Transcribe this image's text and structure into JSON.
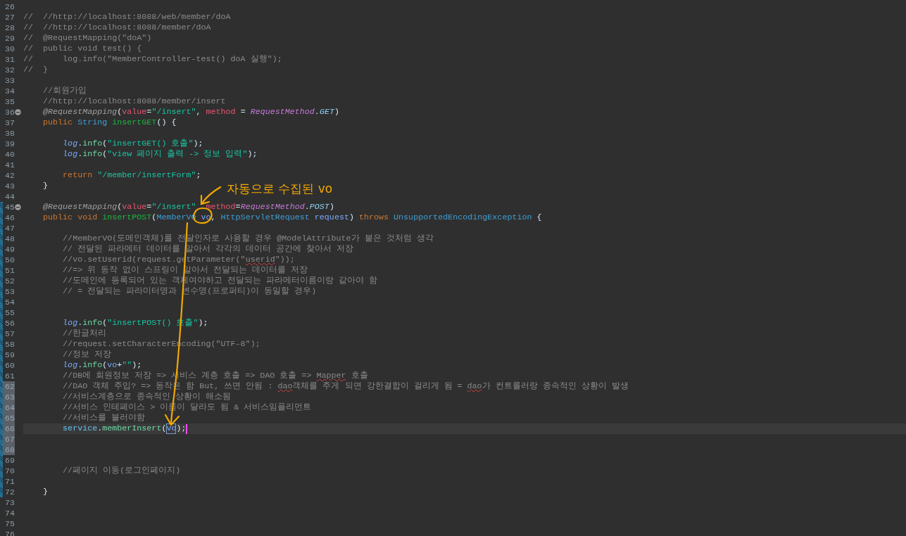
{
  "editor": {
    "lines": [
      {
        "number": "26"
      },
      {
        "number": "27",
        "tokens": [
          {
            "kind": "comment",
            "text": "//  //http://localhost:8088/web/member/doA"
          }
        ]
      },
      {
        "number": "28",
        "tokens": [
          {
            "kind": "comment",
            "text": "//  //http://localhost:8088/member/doA"
          }
        ]
      },
      {
        "number": "29",
        "tokens": [
          {
            "kind": "comment",
            "text": "//  @RequestMapping(\"doA\")"
          }
        ]
      },
      {
        "number": "30",
        "tokens": [
          {
            "kind": "comment",
            "text": "//  public void test() {"
          }
        ]
      },
      {
        "number": "31",
        "tokens": [
          {
            "kind": "comment",
            "text": "//      log.info(\"MemberController-test() doA 실행\");"
          }
        ]
      },
      {
        "number": "32",
        "tokens": [
          {
            "kind": "comment",
            "text": "//  }"
          }
        ]
      },
      {
        "number": "33"
      },
      {
        "number": "34",
        "tokens": [
          {
            "kind": "comment",
            "text": "    //회원가입"
          }
        ]
      },
      {
        "number": "35",
        "tokens": [
          {
            "kind": "comment",
            "text": "    //http://localhost:8088/member/insert"
          }
        ]
      },
      {
        "number": "36",
        "expanded": true,
        "tokens": [
          {
            "kind": "annotation",
            "text": "    @RequestMapping"
          },
          {
            "kind": "plain",
            "text": "("
          },
          {
            "kind": "param",
            "text": "value"
          },
          {
            "kind": "plain",
            "text": "="
          },
          {
            "kind": "string",
            "text": "\"/insert\""
          },
          {
            "kind": "plain",
            "text": ", "
          },
          {
            "kind": "param",
            "text": "method"
          },
          {
            "kind": "plain",
            "text": " = "
          },
          {
            "kind": "enum",
            "text": "RequestMethod"
          },
          {
            "kind": "plain",
            "text": "."
          },
          {
            "kind": "constant",
            "text": "GET"
          },
          {
            "kind": "plain",
            "text": ")"
          }
        ]
      },
      {
        "number": "37",
        "tokens": [
          {
            "kind": "keyword",
            "text": "    public "
          },
          {
            "kind": "type",
            "text": "String "
          },
          {
            "kind": "method",
            "text": "insertGET"
          },
          {
            "kind": "plain",
            "text": "() {"
          }
        ]
      },
      {
        "number": "38"
      },
      {
        "number": "39",
        "tokens": [
          {
            "kind": "static",
            "text": "        log"
          },
          {
            "kind": "plain",
            "text": "."
          },
          {
            "kind": "call",
            "text": "info"
          },
          {
            "kind": "plain",
            "text": "("
          },
          {
            "kind": "string",
            "text": "\"insertGET() 호출\""
          },
          {
            "kind": "plain",
            "text": ");"
          }
        ]
      },
      {
        "number": "40",
        "tokens": [
          {
            "kind": "static",
            "text": "        log"
          },
          {
            "kind": "plain",
            "text": "."
          },
          {
            "kind": "call",
            "text": "info"
          },
          {
            "kind": "plain",
            "text": "("
          },
          {
            "kind": "string",
            "text": "\"view 페이지 출력 -> 정보 입력\""
          },
          {
            "kind": "plain",
            "text": ");"
          }
        ]
      },
      {
        "number": "41"
      },
      {
        "number": "42",
        "tokens": [
          {
            "kind": "keyword",
            "text": "        return "
          },
          {
            "kind": "string",
            "text": "\"/member/insertForm\""
          },
          {
            "kind": "plain",
            "text": ";"
          }
        ]
      },
      {
        "number": "43",
        "tokens": [
          {
            "kind": "plain",
            "text": "    }"
          }
        ]
      },
      {
        "number": "44"
      },
      {
        "number": "45",
        "expanded": true,
        "changed": true,
        "tokens": [
          {
            "kind": "annotation",
            "text": "    @RequestMapping"
          },
          {
            "kind": "plain",
            "text": "("
          },
          {
            "kind": "param",
            "text": "value"
          },
          {
            "kind": "plain",
            "text": "="
          },
          {
            "kind": "string",
            "text": "\"/insert\""
          },
          {
            "kind": "param",
            "text": "  method"
          },
          {
            "kind": "plain",
            "text": "="
          },
          {
            "kind": "enum",
            "text": "RequestMethod"
          },
          {
            "kind": "plain",
            "text": "."
          },
          {
            "kind": "constant",
            "text": "POST"
          },
          {
            "kind": "plain",
            "text": ")"
          }
        ]
      },
      {
        "number": "46",
        "changed": true,
        "tokens": [
          {
            "kind": "keyword",
            "text": "    public void "
          },
          {
            "kind": "method",
            "text": "insertPOST"
          },
          {
            "kind": "plain",
            "text": "("
          },
          {
            "kind": "type",
            "text": "MemberVO "
          },
          {
            "kind": "local",
            "text": "vo"
          },
          {
            "kind": "plain",
            "text": ", "
          },
          {
            "kind": "type",
            "text": "HttpServletRequest "
          },
          {
            "kind": "local",
            "text": "request"
          },
          {
            "kind": "plain",
            "text": ") "
          },
          {
            "kind": "keyword",
            "text": "throws "
          },
          {
            "kind": "type",
            "text": "UnsupportedEncodingException"
          },
          {
            "kind": "plain",
            "text": " {"
          }
        ]
      },
      {
        "number": "47",
        "changed": true
      },
      {
        "number": "48",
        "changed": true,
        "tokens": [
          {
            "kind": "comment",
            "text": "        //MemberVO(도메인객체)를 전달인자로 사용할 경우 @ModelAttribute가 붙은 것처럼 생각"
          }
        ]
      },
      {
        "number": "49",
        "changed": true,
        "tokens": [
          {
            "kind": "comment",
            "text": "        // 전달된 파라메터 데이터를 알아서 각각의 데이터 공간에 찾아서 저장"
          }
        ]
      },
      {
        "number": "50",
        "changed": true,
        "tokens": [
          {
            "kind": "comment",
            "text": "        //vo.setUserid(request.getParameter(\""
          },
          {
            "kind": "comment",
            "text": "userid",
            "warning": true
          },
          {
            "kind": "comment",
            "text": "\"));"
          }
        ]
      },
      {
        "number": "51",
        "changed": true,
        "tokens": [
          {
            "kind": "comment",
            "text": "        //=> 위 동작 없이 스프링이 알아서 전달되는 데이터를 저장"
          }
        ]
      },
      {
        "number": "52",
        "changed": true,
        "tokens": [
          {
            "kind": "comment",
            "text": "        //도메인에 등록되어 있는 객체여야하고 전달되는 파라메터이름이랑 같아야 함"
          }
        ]
      },
      {
        "number": "53",
        "changed": true,
        "tokens": [
          {
            "kind": "comment",
            "text": "        // = 전달되는 파라미터명과 변수명(프로퍼티)이 동일할 경우)"
          }
        ]
      },
      {
        "number": "54",
        "changed": true
      },
      {
        "number": "55",
        "changed": true
      },
      {
        "number": "56",
        "changed": true,
        "tokens": [
          {
            "kind": "static",
            "text": "        log"
          },
          {
            "kind": "plain",
            "text": "."
          },
          {
            "kind": "call",
            "text": "info"
          },
          {
            "kind": "plain",
            "text": "("
          },
          {
            "kind": "string",
            "text": "\"insertPOST() 호출\""
          },
          {
            "kind": "plain",
            "text": ");"
          }
        ]
      },
      {
        "number": "57",
        "changed": true,
        "tokens": [
          {
            "kind": "comment",
            "text": "        //한글처리"
          }
        ]
      },
      {
        "number": "58",
        "changed": true,
        "tokens": [
          {
            "kind": "comment",
            "text": "        //request.setCharacterEncoding(\"UTF-8\");"
          }
        ]
      },
      {
        "number": "59",
        "changed": true,
        "tokens": [
          {
            "kind": "comment",
            "text": "        //정보 저장"
          }
        ]
      },
      {
        "number": "60",
        "changed": true,
        "tokens": [
          {
            "kind": "static",
            "text": "        log"
          },
          {
            "kind": "plain",
            "text": "."
          },
          {
            "kind": "call",
            "text": "info"
          },
          {
            "kind": "plain",
            "text": "("
          },
          {
            "kind": "local",
            "text": "vo"
          },
          {
            "kind": "plain",
            "text": "+"
          },
          {
            "kind": "string",
            "text": "\"\""
          },
          {
            "kind": "plain",
            "text": ");"
          }
        ]
      },
      {
        "number": "61",
        "changed": true,
        "tokens": [
          {
            "kind": "comment",
            "text": "        //DB에 회원정보 저장 => 서비스 계층 호출 => DAO 호출 => "
          },
          {
            "kind": "comment",
            "text": "Mapper",
            "warning": true
          },
          {
            "kind": "comment",
            "text": " 호출"
          }
        ]
      },
      {
        "number": "62",
        "changed": true,
        "range": true,
        "tokens": [
          {
            "kind": "comment",
            "text": "        //DAO 객체 주입? => 동작은 함 But, 쓰면 안됨 : "
          },
          {
            "kind": "comment",
            "text": "dao",
            "warning": true
          },
          {
            "kind": "comment",
            "text": "객체를 주게 되면 강한결합이 걸리게 됨 = "
          },
          {
            "kind": "comment",
            "text": "dao",
            "warning": true
          },
          {
            "kind": "comment",
            "text": "가 컨트롤러랑 종속적인 상황이 발생"
          }
        ]
      },
      {
        "number": "63",
        "changed": true,
        "range": true,
        "tokens": [
          {
            "kind": "comment",
            "text": "        //서비스계층으로 종속적인 상황이 해소됨"
          }
        ]
      },
      {
        "number": "64",
        "changed": true,
        "range": true,
        "tokens": [
          {
            "kind": "comment",
            "text": "        //서비스 인테페이스 > 이름이 달라도 됨 & 서비스임플리먼트"
          }
        ]
      },
      {
        "number": "65",
        "changed": true,
        "range": true,
        "tokens": [
          {
            "kind": "comment",
            "text": "        //서비스를 불러야함"
          }
        ]
      },
      {
        "number": "66",
        "changed": true,
        "range": true,
        "current": true,
        "tokens": [
          {
            "kind": "field",
            "text": "        service"
          },
          {
            "kind": "plain",
            "text": "."
          },
          {
            "kind": "call",
            "text": "memberInsert"
          },
          {
            "kind": "plain",
            "text": "("
          },
          {
            "kind": "local",
            "text": "vo",
            "boxed": true
          },
          {
            "kind": "plain",
            "text": ");"
          }
        ]
      },
      {
        "number": "67",
        "changed": true,
        "range": true
      },
      {
        "number": "68",
        "changed": true,
        "range": true
      },
      {
        "number": "69",
        "changed": true
      },
      {
        "number": "70",
        "changed": true,
        "tokens": [
          {
            "kind": "comment",
            "text": "        //페이지 이동(로그인페이지)"
          }
        ]
      },
      {
        "number": "71",
        "changed": true
      },
      {
        "number": "72",
        "changed": true,
        "tokens": [
          {
            "kind": "plain",
            "text": "    }"
          }
        ]
      },
      {
        "number": "73"
      },
      {
        "number": "74"
      },
      {
        "number": "75"
      },
      {
        "number": "76"
      }
    ]
  },
  "annotation": {
    "text": "자동으로 수집된 vo"
  }
}
